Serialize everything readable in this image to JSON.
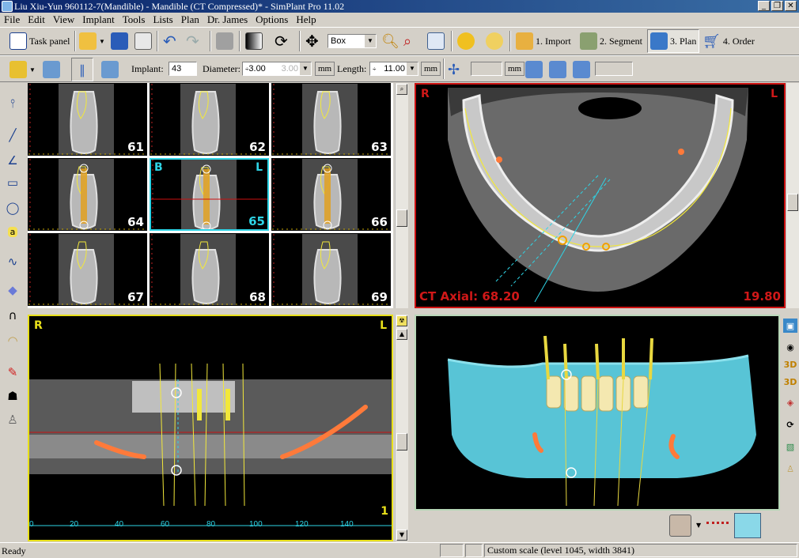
{
  "window": {
    "title": "Liu Xiu-Yun 960112-7(Mandible) - Mandible (CT Compressed)* - SimPlant Pro  11.02",
    "minimize": "_",
    "restore": "❐",
    "close": "✕"
  },
  "menu": [
    "File",
    "Edit",
    "View",
    "Implant",
    "Tools",
    "Lists",
    "Plan",
    "Dr. James",
    "Options",
    "Help"
  ],
  "toolbar": {
    "task_panel": "Task panel",
    "view_mode": "Box",
    "steps": [
      "1. Import",
      "2. Segment",
      "3. Plan",
      "4. Order"
    ]
  },
  "implant_bar": {
    "implant_label": "Implant:",
    "implant_value": "43",
    "diameter_label": "Diameter:",
    "diameter_value": "3.00",
    "diameter_alt": "3.00",
    "diameter_unit": "mm",
    "length_label": "Length:",
    "length_value": "11.00",
    "length_unit": "mm",
    "extra_unit": "mm"
  },
  "cross_sections": {
    "slices": [
      "61",
      "62",
      "63",
      "64",
      "65",
      "66",
      "67",
      "68",
      "69"
    ],
    "selected": "65",
    "orient_left": "B",
    "orient_right": "L"
  },
  "axial": {
    "corner_left": "R",
    "corner_right": "L",
    "label": "CT Axial: 68.20",
    "value": "19.80"
  },
  "panoramic": {
    "corner_left": "R",
    "corner_right": "L",
    "ticks": [
      "0",
      "20",
      "40",
      "60",
      "80",
      "100",
      "120",
      "140"
    ],
    "index": "1"
  },
  "colors": {
    "selected_slice": "#2ed4e6",
    "axial_frame": "#cc1111",
    "pano_frame": "#e8e01a",
    "bone_3d": "#58c4d6",
    "implant": "#e8d840",
    "nerve": "#ff7a3a"
  },
  "statusbar": {
    "text": "Ready",
    "scale": "Custom scale (level 1045, width 3841)"
  }
}
